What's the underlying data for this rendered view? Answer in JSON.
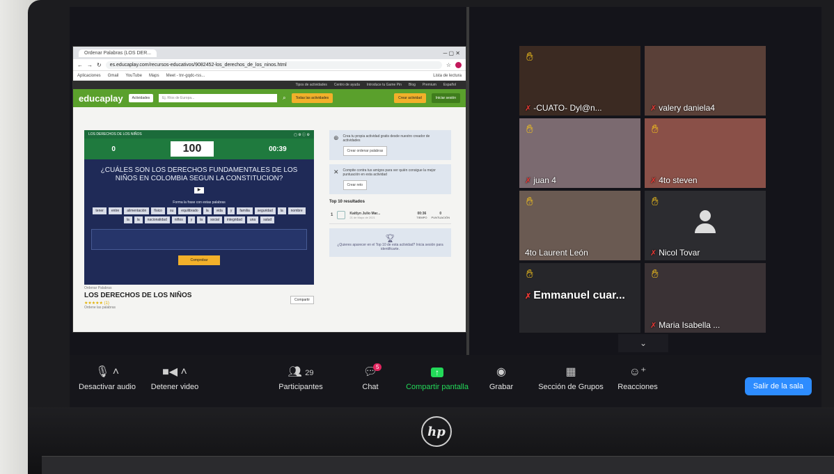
{
  "browser": {
    "tab_label": "Ordenar Palabras (LOS DER...",
    "url": "es.educaplay.com/recursos-educativos/9082452-los_derechos_de_los_ninos.html",
    "bookmarks": [
      "Aplicaciones",
      "Gmail",
      "YouTube",
      "Maps",
      "Meet - tnr-gqdc-rss..."
    ],
    "reading_list": "Lista de lectura",
    "top_links": [
      "Tipos de actividades",
      "Centro de ayuda",
      "Introduce tu Game Pin",
      "Blog",
      "Premium",
      "Español"
    ]
  },
  "educaplay": {
    "logo": "educaplay",
    "activities_select": "Actividades",
    "search_placeholder": "Ej. Ríos de Europa...",
    "all_activities": "Todas las actividades",
    "create_activity": "Crear actividad",
    "login": "Iniciar sesión"
  },
  "game": {
    "header": "LOS DERECHOS DE LOS NIÑOS",
    "score_left": "0",
    "score_mid": "100",
    "timer": "00:39",
    "question": "¿CUÁLES SON LOS DERECHOS FUNDAMENTALES DE LOS NIÑOS EN COLOMBIA SEGUN LA CONSTITUCION?",
    "play": "▶",
    "instruction": "Forma la frase con estas palabras",
    "words": [
      "tener",
      "entre",
      "alimentación",
      "físico",
      "su",
      "equilibrado",
      "la",
      "vida",
      "y",
      "familia",
      "seguridad",
      "la",
      "nombre",
      "la",
      "la",
      "nacionalidad",
      "niños",
      "y",
      "la",
      "social",
      "integridad",
      "una",
      "salud"
    ],
    "check": "Comprobar"
  },
  "meta": {
    "type": "Ordenar Palabras",
    "title": "LOS DERECHOS DE LOS NIÑOS",
    "stars": "★★★★★ (1)",
    "desc": "Ordene las palabras",
    "share": "Compartir"
  },
  "side": {
    "card1_text": "Crea tu propia actividad gratis desde nuestro creador de actividades",
    "card1_btn": "Crear ordenar palabras",
    "card2_text": "Compite contra tus amigos para ver quién consigue la mejor puntuación en esta actividad",
    "card2_btn": "Crear reto",
    "top10": "Top 10 resultados",
    "result_rank": "1",
    "result_name": "Kaitlyn Julio Mar...",
    "result_date": "21 de Mayo de 2021",
    "result_time": "00:36",
    "result_time_lbl": "TIEMPO",
    "result_score": "0",
    "result_score_lbl": "PUNTUACIÓN",
    "promo": "¿Quieres aparecer en el Top 10 de esta actividad? Inicia sesión para identificarte."
  },
  "participants": [
    {
      "name": "-CUATO- Dyl@n...",
      "hand": true,
      "muted": true
    },
    {
      "name": "valery daniela4",
      "hand": false,
      "muted": true
    },
    {
      "name": "juan 4",
      "hand": true,
      "muted": true
    },
    {
      "name": "4to steven",
      "hand": true,
      "muted": true
    },
    {
      "name": "4to Laurent León",
      "hand": true,
      "muted": false
    },
    {
      "name": "Nicol Tovar",
      "hand": true,
      "muted": true
    },
    {
      "name": "Emmanuel  cuar...",
      "hand": true,
      "muted": true
    },
    {
      "name": "Maria Isabella ...",
      "hand": true,
      "muted": true
    }
  ],
  "toolbar": {
    "mute": "Desactivar audio",
    "video": "Detener video",
    "participants": "Participantes",
    "participants_count": "29",
    "chat": "Chat",
    "chat_badge": "5",
    "share": "Compartir pantalla",
    "record": "Grabar",
    "breakout": "Sección de Grupos",
    "reactions": "Reacciones",
    "leave": "Salir de la sala"
  },
  "laptop_logo": "hp",
  "colors": {
    "accent": "#2d8cff",
    "share_green": "#23d959",
    "hand": "#f4c21c",
    "muted": "#e53935",
    "educaplay_green": "#5aa02c"
  }
}
